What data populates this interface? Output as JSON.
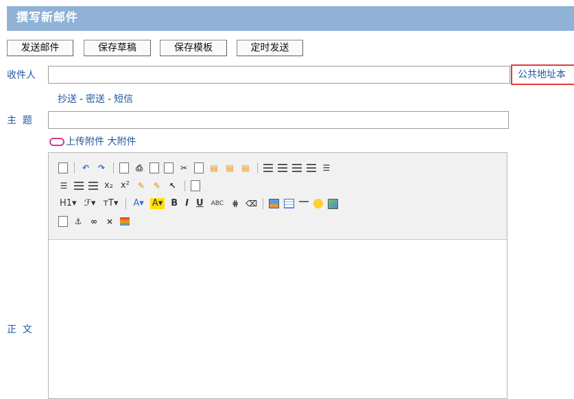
{
  "page": {
    "title": "撰写新邮件"
  },
  "toolbar": {
    "send_label": "发送邮件",
    "save_draft_label": "保存草稿",
    "save_template_label": "保存模板",
    "schedule_send_label": "定时发送"
  },
  "form": {
    "to_label": "收件人",
    "to_value": "",
    "address_book_label": "公共地址本",
    "cc_label": "抄送",
    "bcc_label": "密送",
    "sms_label": "短信",
    "separator": "-",
    "subject_label": "主  题",
    "subject_value": "",
    "upload_attachment_label": "上传附件",
    "large_attachment_label": "大附件",
    "body_label": "正  文"
  },
  "editor": {
    "heading_label": "H1",
    "font_family_label": "ℱ",
    "font_size_label": "тT",
    "font_color_label": "A",
    "highlight_label": "A",
    "bold_label": "B",
    "italic_label": "I",
    "underline_label": "U",
    "strike_label": "ABC",
    "subscript_label": "x₂",
    "superscript_label": "x²"
  }
}
